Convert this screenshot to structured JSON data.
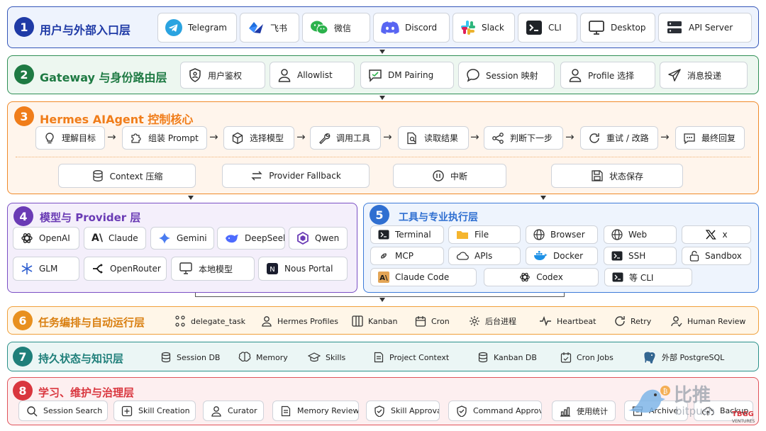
{
  "layer1": {
    "num": "1",
    "title": "用户与外部入口层",
    "items": [
      "Telegram",
      "飞书",
      "微信",
      "Discord",
      "Slack",
      "CLI",
      "Desktop",
      "API Server"
    ]
  },
  "layer2": {
    "num": "2",
    "title": "Gateway 与身份路由层",
    "items": [
      "用户鉴权",
      "Allowlist",
      "DM Pairing",
      "Session 映射",
      "Profile 选择",
      "消息投递"
    ]
  },
  "layer3": {
    "num": "3",
    "title": "Hermes AIAgent 控制核心",
    "flow": [
      "理解目标",
      "组装 Prompt",
      "选择模型",
      "调用工具",
      "读取结果",
      "判断下一步",
      "重试 / 改路",
      "最终回复"
    ],
    "extras": [
      "Context 压缩",
      "Provider Fallback",
      "中断",
      "状态保存"
    ]
  },
  "layer4": {
    "num": "4",
    "title": "模型与 Provider 层",
    "items": [
      "OpenAI",
      "Claude",
      "Gemini",
      "DeepSeek",
      "Qwen",
      "GLM",
      "OpenRouter",
      "本地模型",
      "Nous Portal"
    ]
  },
  "layer5": {
    "num": "5",
    "title": "工具与专业执行层",
    "items": [
      "Terminal",
      "File",
      "Browser",
      "Web",
      "x",
      "MCP",
      "APIs",
      "Docker",
      "SSH",
      "Sandbox",
      "Claude Code",
      "Codex",
      "等 CLI"
    ]
  },
  "layer6": {
    "num": "6",
    "title": "任务编排与自动运行层",
    "items": [
      "delegate_task",
      "Hermes Profiles",
      "Kanban",
      "Cron",
      "后台进程",
      "Heartbeat",
      "Retry",
      "Human Review"
    ]
  },
  "layer7": {
    "num": "7",
    "title": "持久状态与知识层",
    "items": [
      "Session DB",
      "Memory",
      "Skills",
      "Project Context",
      "Kanban DB",
      "Cron Jobs",
      "外部 PostgreSQL"
    ]
  },
  "layer8": {
    "num": "8",
    "title": "学习、维护与治理层",
    "items": [
      "Session Search",
      "Skill Creation",
      "Curator",
      "Memory Review",
      "Skill Approval",
      "Command Approval",
      "使用统计",
      "Archive",
      "Backup"
    ]
  },
  "watermark": {
    "text": "比推",
    "sub": "bitpush",
    "brand": "TBGG",
    "brand_sub": "VENTURES"
  },
  "colors": {
    "l1": "#1f3aa6",
    "l2": "#1e7a43",
    "l3": "#f07d1a",
    "l4": "#6a3bb5",
    "l5": "#2f6fd1",
    "l6": "#e8901f",
    "l7": "#1f7f7a",
    "l8": "#d9363e"
  }
}
